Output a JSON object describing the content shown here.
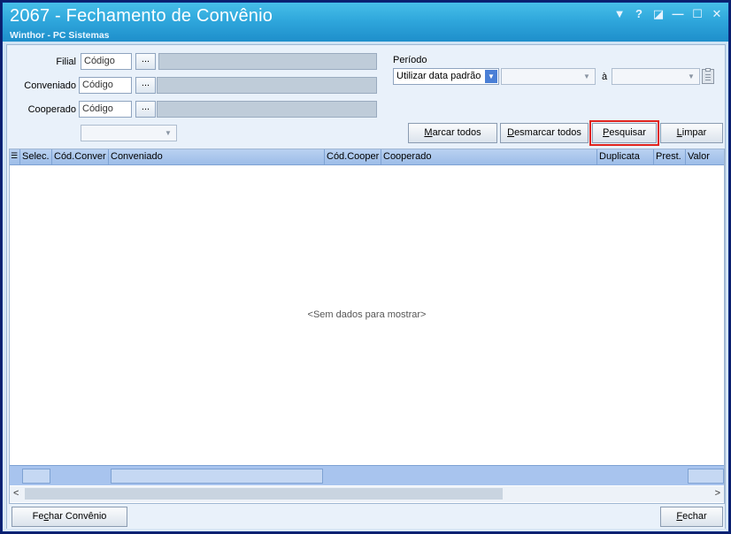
{
  "window": {
    "title": "2067 - Fechamento de Convênio",
    "subtitle": "Winthor - PC Sistemas",
    "controls": [
      "▼",
      "?",
      "◪",
      "—",
      "☐",
      "✕"
    ]
  },
  "filters": {
    "filial_label": "Filial",
    "conveniado_label": "Conveniado",
    "cooperado_label": "Cooperado",
    "codigo_placeholder": "Código",
    "ellipsis": "...",
    "periodo_label": "Período",
    "periodo_value": "Utilizar data padrão",
    "ate_label": "à"
  },
  "buttons": {
    "marcar_todos": {
      "pre": "",
      "u": "M",
      "post": "arcar todos"
    },
    "desmarcar_todos": {
      "pre": "",
      "u": "D",
      "post": "esmarcar todos"
    },
    "pesquisar": {
      "pre": "",
      "u": "P",
      "post": "esquisar"
    },
    "limpar": {
      "pre": "",
      "u": "L",
      "post": "impar"
    },
    "fechar_convenio": {
      "pre": "Fe",
      "u": "c",
      "post": "har Convênio"
    },
    "fechar": {
      "pre": "",
      "u": "F",
      "post": "echar"
    }
  },
  "grid": {
    "columns": [
      "Selec.",
      "Cód.Conver",
      "Conveniado",
      "Cód.Cooper",
      "Cooperado",
      "Duplicata",
      "Prest.",
      "Valor"
    ],
    "empty_message": "<Sem dados para mostrar>"
  },
  "colors": {
    "title_bar": "#2fa7dc",
    "grid_header": "#9dbde8",
    "highlight_border": "#e0231d"
  }
}
